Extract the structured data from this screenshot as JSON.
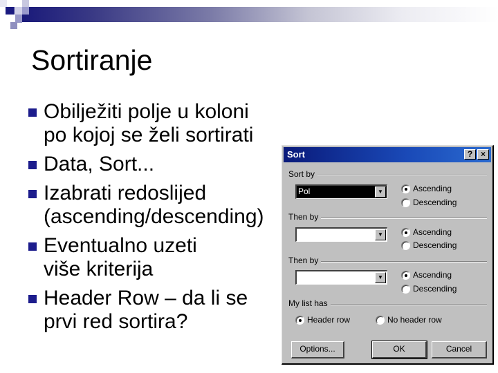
{
  "slide": {
    "title": "Sortiranje",
    "bullets": [
      {
        "lines": [
          "Obilježiti polje u koloni",
          "po kojoj se želi sortirati"
        ]
      },
      {
        "lines": [
          "Data, Sort..."
        ]
      },
      {
        "lines": [
          "Izabrati redoslijed",
          "(ascending/descending)"
        ]
      },
      {
        "lines": [
          "Eventualno uzeti",
          "više kriterija"
        ]
      },
      {
        "lines": [
          "Header Row – da li se",
          "prvi red sortira?"
        ]
      }
    ],
    "bullet_color": "#1c1c8c"
  },
  "dialog": {
    "title": "Sort",
    "help_button": "?",
    "close_button": "×",
    "sort_by": {
      "label": "Sort by",
      "value": "Pol",
      "ascending": "Ascending",
      "descending": "Descending",
      "selected": "ascending"
    },
    "then_by_1": {
      "label": "Then by",
      "value": "",
      "ascending": "Ascending",
      "descending": "Descending",
      "selected": "ascending"
    },
    "then_by_2": {
      "label": "Then by",
      "value": "",
      "ascending": "Ascending",
      "descending": "Descending",
      "selected": "ascending"
    },
    "my_list_has": {
      "label": "My list has",
      "header_row": "Header row",
      "no_header_row": "No header row",
      "selected": "header_row"
    },
    "buttons": {
      "options": "Options...",
      "ok": "OK",
      "cancel": "Cancel"
    },
    "title_bar_color": "#0a246a"
  }
}
